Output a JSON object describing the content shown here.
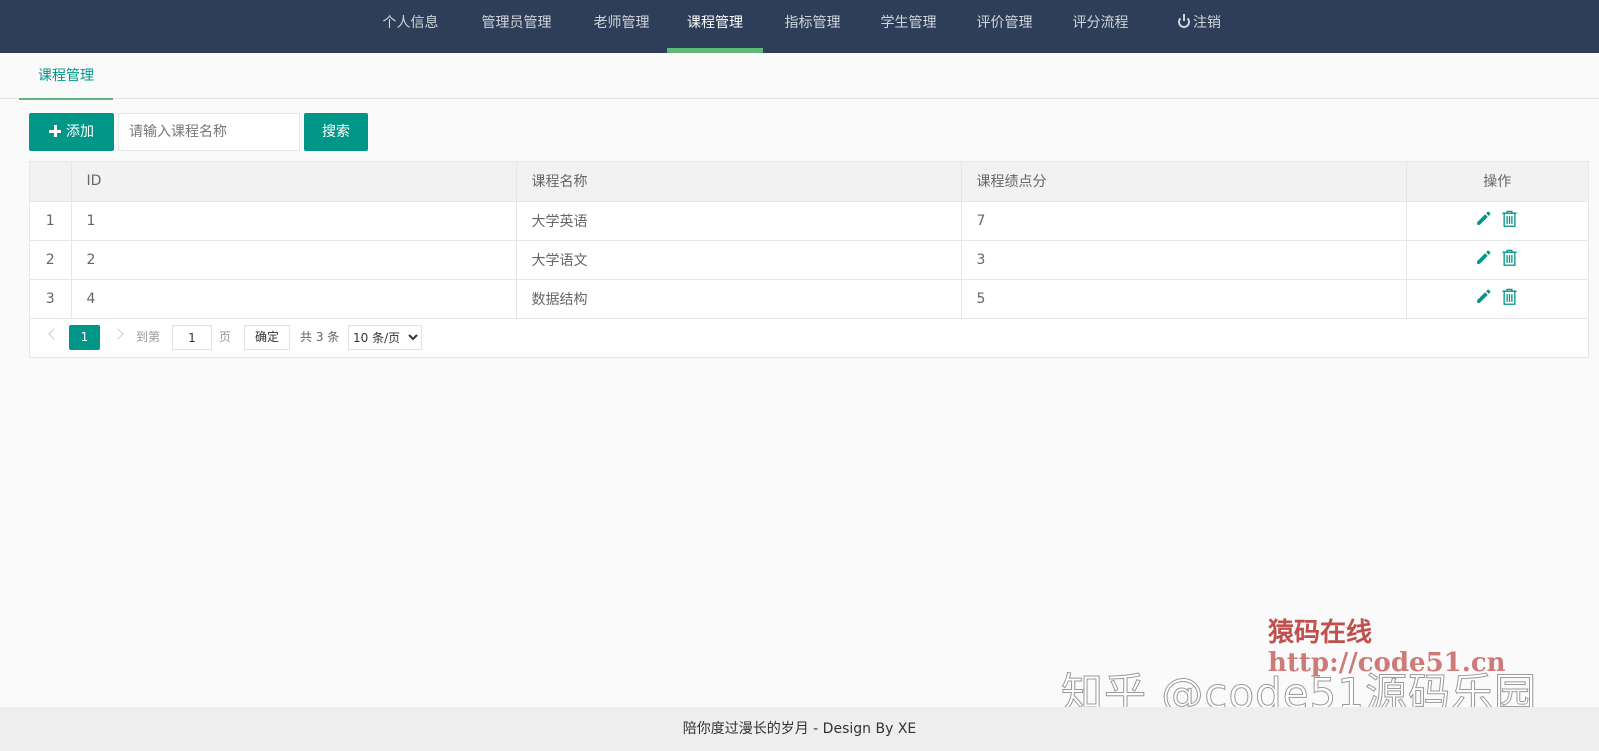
{
  "nav": {
    "items": [
      {
        "label": "个人信息"
      },
      {
        "label": "管理员管理"
      },
      {
        "label": "老师管理"
      },
      {
        "label": "课程管理"
      },
      {
        "label": "指标管理"
      },
      {
        "label": "学生管理"
      },
      {
        "label": "评价管理"
      },
      {
        "label": "评分流程"
      },
      {
        "label": "注销"
      }
    ]
  },
  "tab": {
    "label": "课程管理"
  },
  "toolbar": {
    "add_label": "添加",
    "search_placeholder": "请输入课程名称",
    "search_label": "搜索"
  },
  "table": {
    "headers": [
      "",
      "ID",
      "课程名称",
      "课程绩点分",
      "操作"
    ],
    "rows": [
      {
        "no": "1",
        "id": "1",
        "name": "大学英语",
        "gpa": "7"
      },
      {
        "no": "2",
        "id": "2",
        "name": "大学语文",
        "gpa": "3"
      },
      {
        "no": "3",
        "id": "4",
        "name": "数据结构",
        "gpa": "5"
      }
    ]
  },
  "pagination": {
    "current": "1",
    "goto_label": "到第",
    "page_input": "1",
    "page_unit": "页",
    "confirm_label": "确定",
    "total": "共 3 条",
    "page_size": "10 条/页"
  },
  "watermark": {
    "title": "猿码在线",
    "url": "http://code51.cn",
    "zhihu": "知乎 @code51源码乐园"
  },
  "footer": {
    "text": "陪你度过漫长的岁月 - Design By XE"
  },
  "colors": {
    "nav_bg": "#2f3e58",
    "accent": "#009688",
    "active_bar": "#5fb878",
    "watermark": "#c0504d"
  }
}
